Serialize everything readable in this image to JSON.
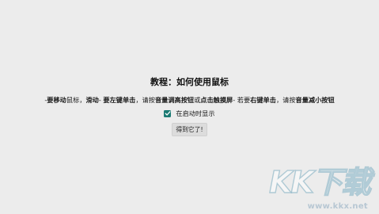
{
  "dialog": {
    "title": "教程：如何使用鼠标",
    "instructions": {
      "dash": "-",
      "move_bold": "要移动",
      "move_plain": "鼠标，",
      "slide_bold": "滑动",
      "sep1": "- ",
      "left_bold": "要左键单击",
      "left_mid": "，请按",
      "vol_up_bold": "音量调高按钮",
      "or_text": "或",
      "touch_bold": "点击触摸屏",
      "sep2": "- 若要",
      "right_bold": "右键单击",
      "right_mid": "，请按",
      "vol_down_bold": "音量减小按钮"
    },
    "checkbox": {
      "label": "在启动时显示",
      "checked": true,
      "color": "#1b7a73"
    },
    "ok_button_label": "得到它了!"
  },
  "watermark": {
    "logo": "KK下载",
    "url": "www.kkx.net"
  }
}
